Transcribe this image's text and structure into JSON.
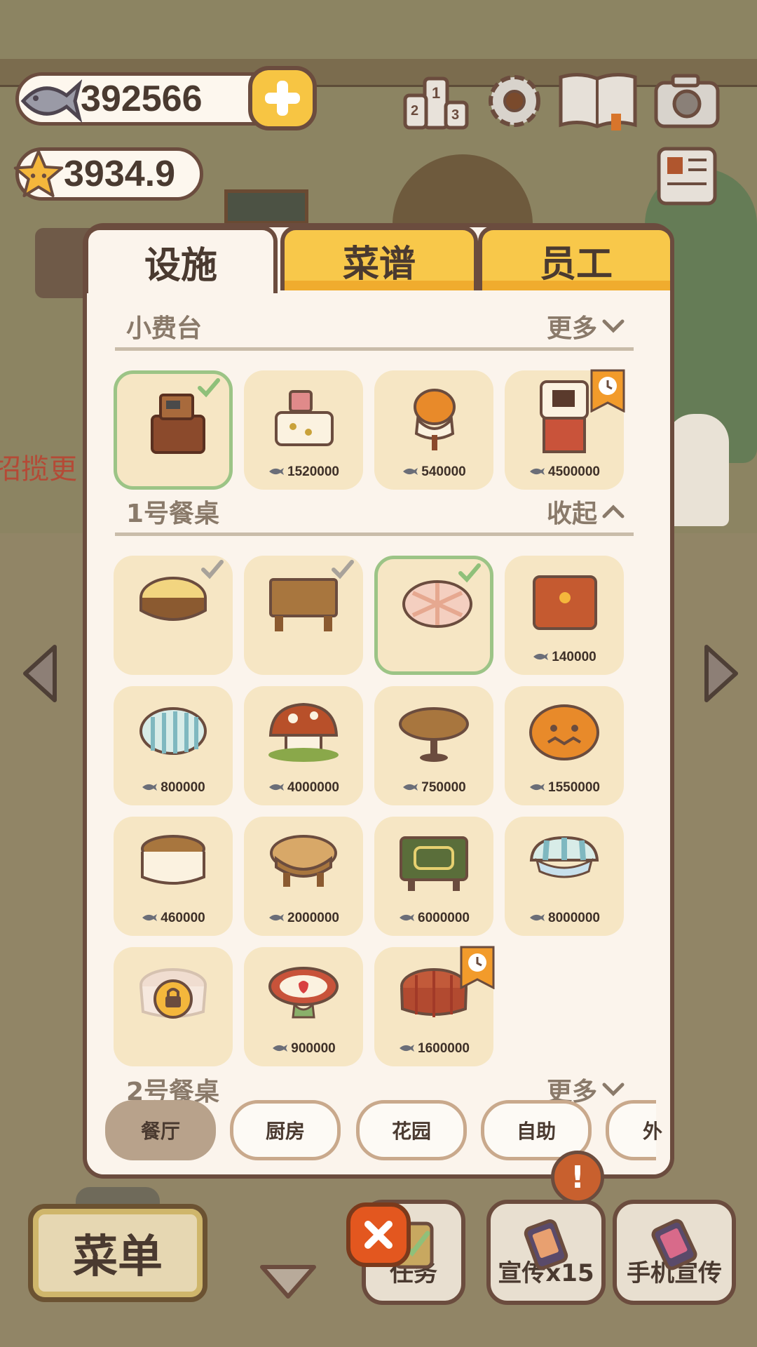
{
  "hud": {
    "fish_coins": "392566",
    "stars": "3934.9"
  },
  "background": {
    "partial_text": "招揽更"
  },
  "tabs": [
    {
      "label": "设施",
      "active": true
    },
    {
      "label": "菜谱",
      "active": false
    },
    {
      "label": "员工",
      "active": false
    }
  ],
  "sections": [
    {
      "title": "小费台",
      "toggle": "更多"
    },
    {
      "title": "1号餐桌",
      "toggle": "收起"
    },
    {
      "title": "2号餐桌",
      "toggle": "更多"
    }
  ],
  "tip_counter_items": [
    {
      "price": "",
      "selected": true,
      "owned": true
    },
    {
      "price": "1520000"
    },
    {
      "price": "540000"
    },
    {
      "price": "4500000",
      "limited": true
    }
  ],
  "table_items": [
    {
      "price": "",
      "owned": true
    },
    {
      "price": "",
      "owned": true
    },
    {
      "price": "",
      "owned": true,
      "selected": true
    },
    {
      "price": "140000"
    },
    {
      "price": "800000"
    },
    {
      "price": "4000000"
    },
    {
      "price": "750000"
    },
    {
      "price": "1550000"
    },
    {
      "price": "460000"
    },
    {
      "price": "2000000"
    },
    {
      "price": "6000000"
    },
    {
      "price": "8000000"
    },
    {
      "price": "",
      "locked": true
    },
    {
      "price": "900000"
    },
    {
      "price": "1600000",
      "limited": true
    }
  ],
  "filters": [
    {
      "label": "餐厅",
      "active": true
    },
    {
      "label": "厨房"
    },
    {
      "label": "花园"
    },
    {
      "label": "自助"
    },
    {
      "label": "外"
    }
  ],
  "bottom": {
    "menu": "菜单",
    "task": "任务",
    "promo": "宣传x15",
    "phone_promo": "手机宣传",
    "alert": "!"
  },
  "colors": {
    "panel_bg": "#fbf4ec",
    "border": "#6b4c3e",
    "tab_yellow": "#f8c84a",
    "card_bg": "#f6e6c4",
    "selected_border": "#9cc486",
    "limited_badge": "#f29b2b",
    "close_btn": "#e3571f"
  }
}
